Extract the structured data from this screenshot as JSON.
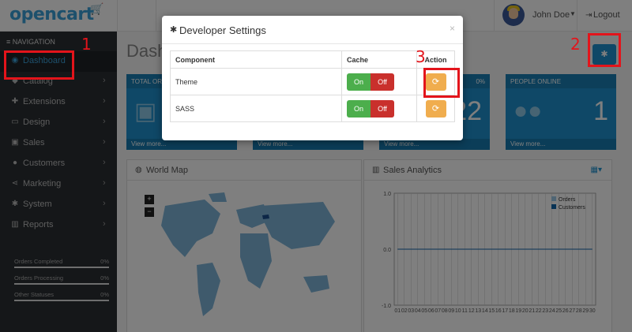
{
  "header": {
    "logo_text": "opencart",
    "cart_glyph": "🛒",
    "user_name": "John Doe",
    "logout_label": "Logout"
  },
  "sidebar": {
    "nav_header": "≡ NAVIGATION",
    "items": [
      {
        "label": "Dashboard",
        "icon": "dashboard-icon",
        "glyph": "◉",
        "active": true
      },
      {
        "label": "Catalog",
        "icon": "tag-icon",
        "glyph": "◆"
      },
      {
        "label": "Extensions",
        "icon": "puzzle-icon",
        "glyph": "✚"
      },
      {
        "label": "Design",
        "icon": "monitor-icon",
        "glyph": "▭"
      },
      {
        "label": "Sales",
        "icon": "cart-icon",
        "glyph": "▣"
      },
      {
        "label": "Customers",
        "icon": "user-icon",
        "glyph": "●"
      },
      {
        "label": "Marketing",
        "icon": "share-icon",
        "glyph": "⋖"
      },
      {
        "label": "System",
        "icon": "gear-icon",
        "glyph": "✱"
      },
      {
        "label": "Reports",
        "icon": "bar-chart-icon",
        "glyph": "▥"
      }
    ],
    "stats": [
      {
        "label": "Orders Completed",
        "value": "0%"
      },
      {
        "label": "Orders Processing",
        "value": "0%"
      },
      {
        "label": "Other Statuses",
        "value": "0%"
      }
    ]
  },
  "main": {
    "page_title": "Dash",
    "tiles": [
      {
        "head": "TOTAL OR",
        "pct": "",
        "value": "",
        "foot": "View more..."
      },
      {
        "head": "",
        "pct": "",
        "value": "",
        "foot": "View more..."
      },
      {
        "head": "",
        "pct": "0%",
        "value": "22",
        "foot": "View more..."
      },
      {
        "head": "PEOPLE ONLINE",
        "pct": "",
        "value": "1",
        "foot": "View more..."
      }
    ],
    "world_map": {
      "title": "World Map",
      "zoom_in": "+",
      "zoom_out": "−"
    },
    "sales_analytics": {
      "title": "Sales Analytics"
    }
  },
  "modal": {
    "title": "Developer Settings",
    "close": "×",
    "columns": [
      "Component",
      "Cache",
      "Action"
    ],
    "rows": [
      {
        "component": "Theme",
        "on": "On",
        "off": "Off",
        "action_glyph": "⟳"
      },
      {
        "component": "SASS",
        "on": "On",
        "off": "Off",
        "action_glyph": "⟳"
      }
    ]
  },
  "annotations": {
    "one": "1",
    "two": "2",
    "three": "3"
  },
  "chart_data": {
    "type": "line",
    "x": [
      "01",
      "02",
      "03",
      "04",
      "05",
      "06",
      "07",
      "08",
      "09",
      "10",
      "11",
      "12",
      "13",
      "14",
      "15",
      "16",
      "17",
      "18",
      "19",
      "20",
      "21",
      "22",
      "23",
      "24",
      "25",
      "26",
      "27",
      "28",
      "29",
      "30"
    ],
    "series": [
      {
        "name": "Orders",
        "values": [
          0,
          0,
          0,
          0,
          0,
          0,
          0,
          0,
          0,
          0,
          0,
          0,
          0,
          0,
          0,
          0,
          0,
          0,
          0,
          0,
          0,
          0,
          0,
          0,
          0,
          0,
          0,
          0,
          0,
          0
        ],
        "color": "#9ecae8"
      },
      {
        "name": "Customers",
        "values": [
          0,
          0,
          0,
          0,
          0,
          0,
          0,
          0,
          0,
          0,
          0,
          0,
          0,
          0,
          0,
          0,
          0,
          0,
          0,
          0,
          0,
          0,
          0,
          0,
          0,
          0,
          0,
          0,
          0,
          0
        ],
        "color": "#1065a8"
      }
    ],
    "y_ticks": [
      "1.0",
      "0.0",
      "-1.0"
    ],
    "ylim": [
      -1,
      1
    ],
    "grid": true,
    "legend_position": "top-right"
  },
  "colors": {
    "accent": "#1e91cf",
    "on": "#4cae4c",
    "off": "#c9302c",
    "warning": "#f0ad4e",
    "annotation": "#e3141b"
  }
}
